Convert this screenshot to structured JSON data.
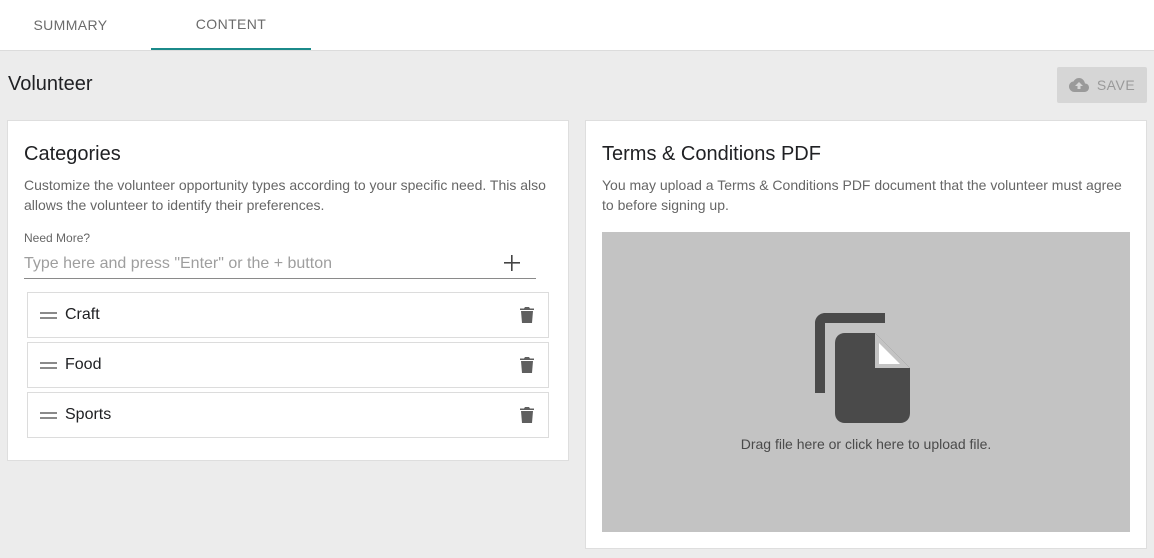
{
  "tabs": [
    {
      "label": "SUMMARY",
      "active": false
    },
    {
      "label": "CONTENT",
      "active": true
    }
  ],
  "page": {
    "title": "Volunteer"
  },
  "toolbar": {
    "save_label": "SAVE",
    "save_icon": "cloud-upload-icon"
  },
  "categories": {
    "title": "Categories",
    "description": "Customize the volunteer opportunity types according to your specific need. This also allows the volunteer to identify their preferences.",
    "input": {
      "label": "Need More?",
      "value": "",
      "placeholder": "Type here and press \"Enter\" or the + button"
    },
    "items": [
      {
        "label": "Craft"
      },
      {
        "label": "Food"
      },
      {
        "label": "Sports"
      }
    ]
  },
  "terms": {
    "title": "Terms & Conditions PDF",
    "description": "You may upload a Terms & Conditions PDF document that the volunteer must agree to before signing up.",
    "upload_hint": "Drag file here or click here to upload file.",
    "upload_icon": "file-copy-icon"
  },
  "colors": {
    "accent": "#1b8a8a",
    "background": "#ececec",
    "dropzone": "#c3c3c3"
  }
}
